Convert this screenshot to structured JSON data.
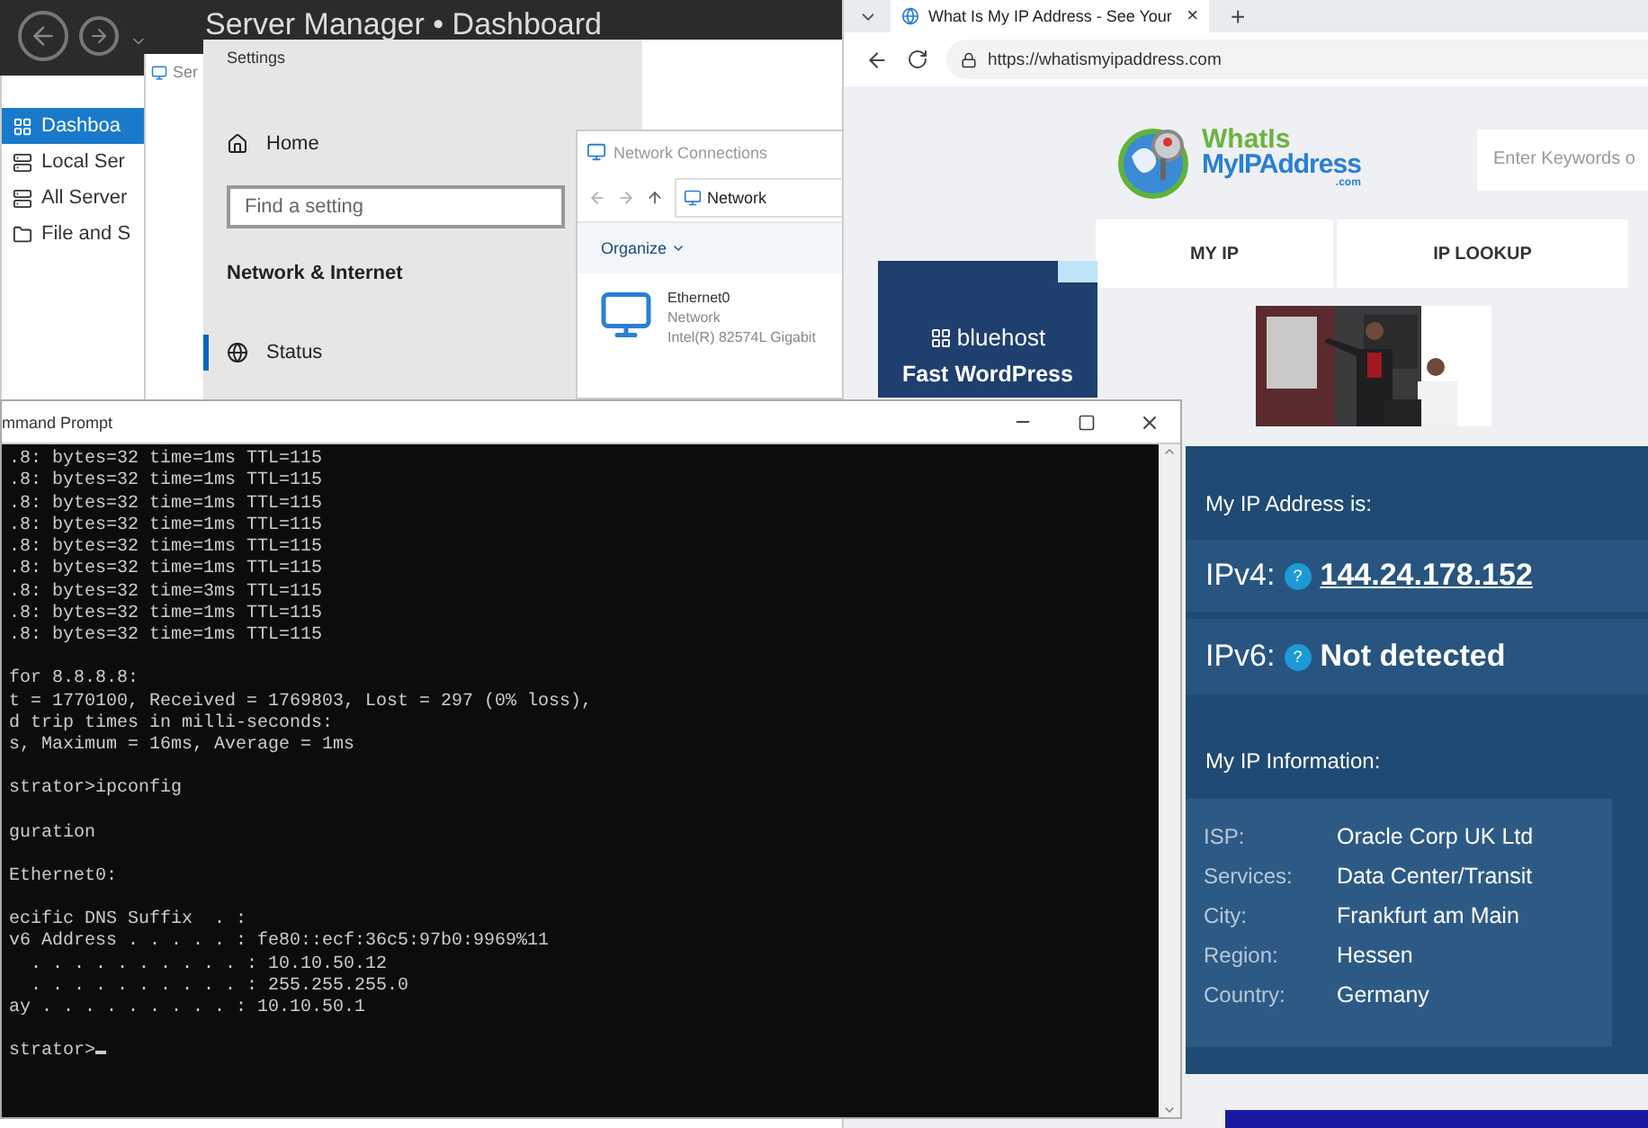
{
  "server_manager": {
    "title": "Server Manager • Dashboard",
    "nav": [
      {
        "label": "Dashboa",
        "selected": true
      },
      {
        "label": "Local Ser",
        "selected": false
      },
      {
        "label": "All Server",
        "selected": false
      },
      {
        "label": "File and S",
        "selected": false
      }
    ]
  },
  "back_window": {
    "title": "Ser"
  },
  "settings": {
    "title": "Settings",
    "home": "Home",
    "search": {
      "placeholder": "Find a setting"
    },
    "section": "Network & Internet",
    "items": [
      {
        "label": "Status",
        "selected": true
      }
    ]
  },
  "network_connections": {
    "title": "Network Connections",
    "address": "Network",
    "organize": "Organize",
    "adapter": {
      "name": "Ethernet0",
      "status": "Network",
      "device": "Intel(R) 82574L Gigabit"
    }
  },
  "browser": {
    "tab": {
      "title": "What Is My IP Address - See Your",
      "close": "×"
    },
    "new_tab": "+",
    "url": "https://whatismyipaddress.com",
    "site": {
      "logo_top": "WhatIs",
      "logo_bottom": "MyIPAddress",
      "logo_suffix": ".com",
      "search": {
        "placeholder": "Enter Keywords o"
      },
      "nav": [
        {
          "label": "MY IP"
        },
        {
          "label": "IP LOOKUP"
        }
      ],
      "ad": {
        "brand": "bluehost",
        "headline": "Fast WordPress"
      },
      "ip_panel": {
        "heading": "My IP Address is:",
        "addresses": [
          {
            "label": "IPv4:",
            "help": "?",
            "value": "144.24.178.152",
            "kind": "link"
          },
          {
            "label": "IPv6:",
            "help": "?",
            "value": "Not detected",
            "kind": "text"
          }
        ],
        "info_heading": "My IP Information:",
        "info": [
          {
            "label": "ISP:",
            "value": "Oracle Corp UK Ltd"
          },
          {
            "label": "Services:",
            "value": "Data Center/Transit"
          },
          {
            "label": "City:",
            "value": "Frankfurt am Main"
          },
          {
            "label": "Region:",
            "value": "Hessen"
          },
          {
            "label": "Country:",
            "value": "Germany"
          }
        ]
      }
    }
  },
  "command_prompt": {
    "title": "mmand Prompt",
    "blocks": [
      [
        ".8: bytes=32 time=1ms TTL=115",
        ".8: bytes=32 time=1ms TTL=115",
        ".8: bytes=32 time=1ms TTL=115",
        ".8: bytes=32 time=1ms TTL=115",
        ".8: bytes=32 time=1ms TTL=115",
        ".8: bytes=32 time=1ms TTL=115",
        ".8: bytes=32 time=3ms TTL=115",
        ".8: bytes=32 time=1ms TTL=115",
        ".8: bytes=32 time=1ms TTL=115"
      ],
      [
        "for 8.8.8.8:",
        "t = 1770100, Received = 1769803, Lost = 297 (0% loss),",
        "d trip times in milli-seconds:",
        "s, Maximum = 16ms, Average = 1ms"
      ],
      [
        "strator>ipconfig"
      ],
      [
        "guration"
      ],
      [
        "Ethernet0:"
      ],
      [
        "ecific DNS Suffix  . :",
        "v6 Address . . . . . : fe80::ecf:36c5:97b0:9969%11",
        "  . . . . . . . . . . : 10.10.50.12",
        "  . . . . . . . . . . : 255.255.255.0",
        "ay . . . . . . . . . : 10.10.50.1"
      ],
      [
        "strator>"
      ]
    ]
  }
}
